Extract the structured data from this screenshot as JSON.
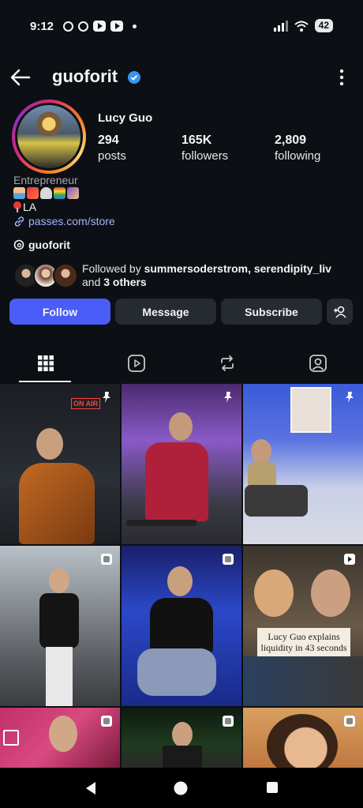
{
  "status_bar": {
    "time": "9:12",
    "battery": "42"
  },
  "header": {
    "username": "guoforit"
  },
  "profile": {
    "full_name": "Lucy Guo",
    "stats": [
      {
        "value": "294",
        "label": "posts"
      },
      {
        "value": "165K",
        "label": "followers"
      },
      {
        "value": "2,809",
        "label": "following"
      }
    ],
    "category": "Entrepreneur",
    "location": "LA",
    "link": "passes.com/store",
    "threads_handle": "guoforit",
    "followed_by": {
      "prefix": "Followed by ",
      "names": "summersoderstrom, serendipity_liv",
      "middle": " and ",
      "others": "3 others"
    }
  },
  "actions": {
    "follow": "Follow",
    "message": "Message",
    "subscribe": "Subscribe"
  },
  "grid": {
    "caption_text": "Lucy Guo explains liquidity in 43 seconds",
    "neon_sign": "ON AIR"
  },
  "colors": {
    "background": "#0c1014",
    "accent": "#4a5df9",
    "link": "#a3b3ff",
    "verified": "#3897f0"
  }
}
